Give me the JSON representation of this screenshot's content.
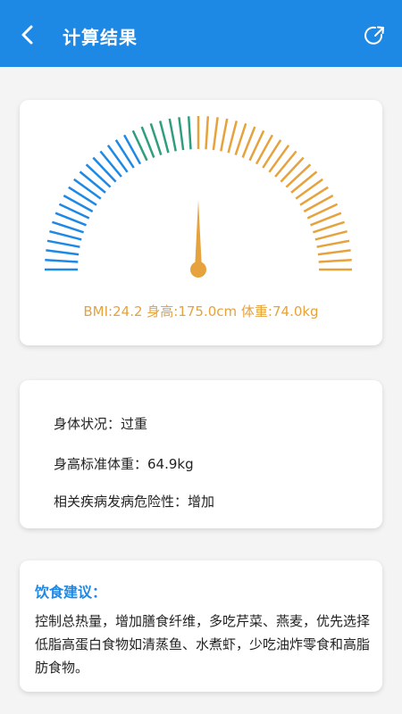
{
  "header": {
    "title": "计算结果",
    "back_icon": "back-arrow-icon",
    "share_icon": "share-icon"
  },
  "gauge": {
    "bmi_value": 24.2,
    "text": {
      "bmi": "BMI:24.2",
      "height": "身高:175.0cm",
      "weight": "体重:74.0kg"
    },
    "colors": {
      "low": "#1e88e5",
      "normal": "#2e9e7e",
      "high": "#e6a23c",
      "needle": "#e6a23c"
    }
  },
  "info": {
    "status": "身体状况：过重",
    "standard_weight": "身高标准体重：64.9kg",
    "risk": "相关疾病发病危险性：增加"
  },
  "diet": {
    "title": "饮食建议：",
    "text": "控制总热量，增加膳食纤维，多吃芹菜、燕麦，优先选择低脂高蛋白食物如清蒸鱼、水煮虾，少吃油炸零食和高脂肪食物。"
  }
}
